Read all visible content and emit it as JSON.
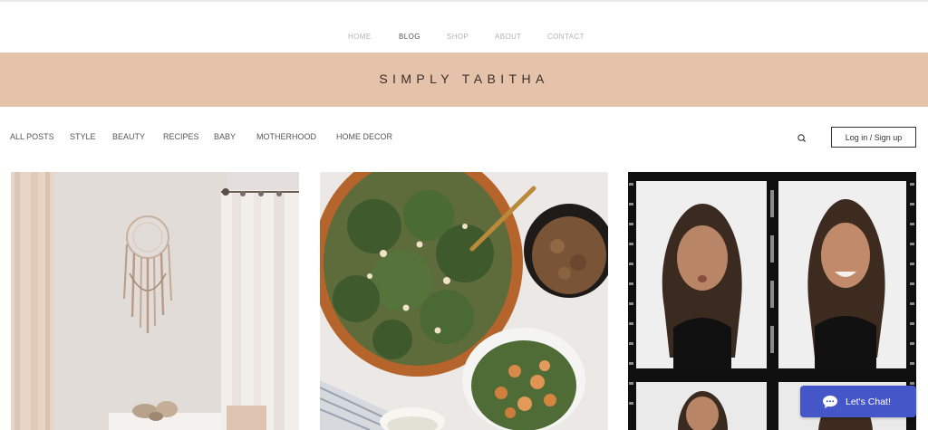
{
  "nav": {
    "items": [
      {
        "label": "HOME",
        "active": false
      },
      {
        "label": "BLOG",
        "active": true
      },
      {
        "label": "SHOP",
        "active": false
      },
      {
        "label": "ABOUT",
        "active": false
      },
      {
        "label": "CONTACT",
        "active": false
      }
    ]
  },
  "banner": {
    "title": "SIMPLY TABITHA",
    "background": "#e5c3ab"
  },
  "categories": {
    "items": [
      "ALL POSTS",
      "STYLE",
      "BEAUTY",
      "RECIPES",
      "BABY",
      "MOTHERHOOD",
      "HOME DECOR"
    ]
  },
  "toolbar": {
    "search_icon": "search-icon",
    "login_label": "Log in / Sign up"
  },
  "posts": [
    {
      "image": "dreamcatcher-room-photo"
    },
    {
      "image": "kale-salad-bowl-photo"
    },
    {
      "image": "film-strip-portraits-photo"
    }
  ],
  "chat": {
    "label": "Let's Chat!",
    "icon": "chat-bubble-icon",
    "color": "#4556c9"
  }
}
